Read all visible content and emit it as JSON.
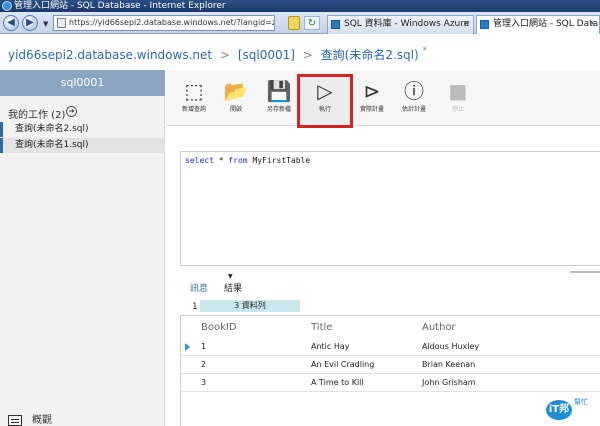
{
  "window": {
    "title": "管理入口網站 - SQL Database - Internet Explorer"
  },
  "browser": {
    "back_glyph": "◀",
    "forward_glyph": "▶",
    "address": "https://yid66sepi2.database.windows.net/?langid=zh-1",
    "refresh_glyph": "↻",
    "tabs": [
      {
        "label": "SQL 資料庫 - Windows Azure",
        "active": false
      },
      {
        "label": "管理入口網站 - SQL Datab...",
        "active": true
      }
    ],
    "tab_close_glyph": "×"
  },
  "breadcrumb": {
    "server": "yid66sepi2.database.windows.net",
    "database": "[sql0001]",
    "query": "查詢(未命名2.sql)",
    "separator": ">",
    "modified_mark": "*"
  },
  "sidebar": {
    "database_tab": "sql0001",
    "my_work_label": "我的工作 (2)",
    "my_work_arrow": "➜",
    "queries": [
      {
        "label": "查詢(未命名2.sql)",
        "selected": false
      },
      {
        "label": "查詢(未命名1.sql)",
        "selected": true
      }
    ],
    "overview_label": "概觀"
  },
  "ribbon": {
    "buttons": [
      {
        "key": "new_query",
        "label": "新增查詢",
        "icon": "new-query-icon",
        "glyph": "⬚"
      },
      {
        "key": "open",
        "label": "開啟",
        "icon": "folder-icon",
        "glyph": "📂"
      },
      {
        "key": "save_as",
        "label": "另存新檔",
        "icon": "save-icon",
        "glyph": "💾"
      },
      {
        "key": "run",
        "label": "執行",
        "icon": "run-icon",
        "glyph": "▷"
      },
      {
        "key": "actual_plan",
        "label": "實際計畫",
        "icon": "actual-plan-icon",
        "glyph": "⊳"
      },
      {
        "key": "estimated_plan",
        "label": "估計計畫",
        "icon": "estimated-plan-icon",
        "glyph": "ⓘ"
      },
      {
        "key": "stop",
        "label": "停止",
        "icon": "stop-icon",
        "glyph": "■"
      }
    ],
    "highlight_color": "#d62222"
  },
  "editor": {
    "keyword1": "select",
    "star": " * ",
    "keyword2": "from",
    "table": " MyFirstTable"
  },
  "results": {
    "messages_tab": "訊息",
    "results_tab": "結果",
    "page_number": "1",
    "row_count": "3 資料列",
    "columns": [
      "BookID",
      "Title",
      "Author"
    ],
    "rows": [
      [
        "1",
        "Antic Hay",
        "Aldous Huxley"
      ],
      [
        "2",
        "An Evil Cradling",
        "Brian Keenan"
      ],
      [
        "3",
        "A Time to Kill",
        "John Grisham"
      ]
    ]
  },
  "watermark": {
    "logo": "iT邦",
    "text": "幫忙"
  }
}
